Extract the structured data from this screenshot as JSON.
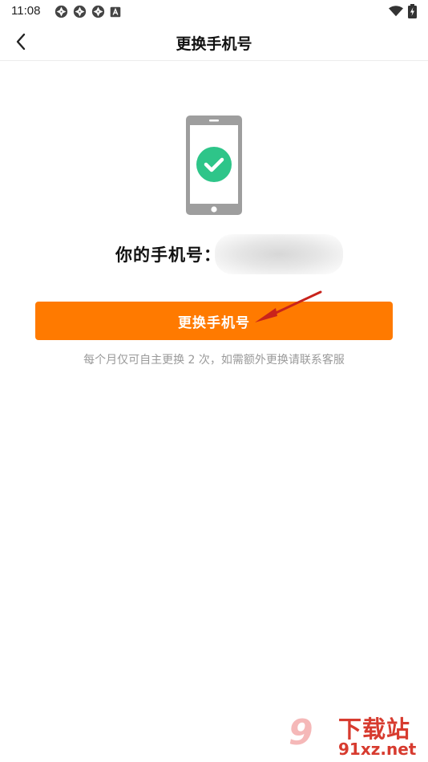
{
  "status_bar": {
    "time": "11:08",
    "icons": [
      "notification-icon",
      "notification-icon",
      "notification-icon",
      "a-badge-icon",
      "wifi-icon",
      "battery-charging-icon"
    ]
  },
  "header": {
    "title": "更换手机号"
  },
  "main": {
    "phone_label": "你的手机号：",
    "phone_value": "",
    "change_button_label": "更换手机号",
    "hint": "每个月仅可自主更换 2 次，如需额外更换请联系客服"
  },
  "watermark": {
    "logo_text": "9",
    "title": "下载站",
    "domain": "91xz.net"
  },
  "colors": {
    "accent": "#ff7a00",
    "check": "#2ec589",
    "phone_gray": "#9e9e9e",
    "hint": "#9a9a9a",
    "watermark_red": "#d73b2f"
  }
}
